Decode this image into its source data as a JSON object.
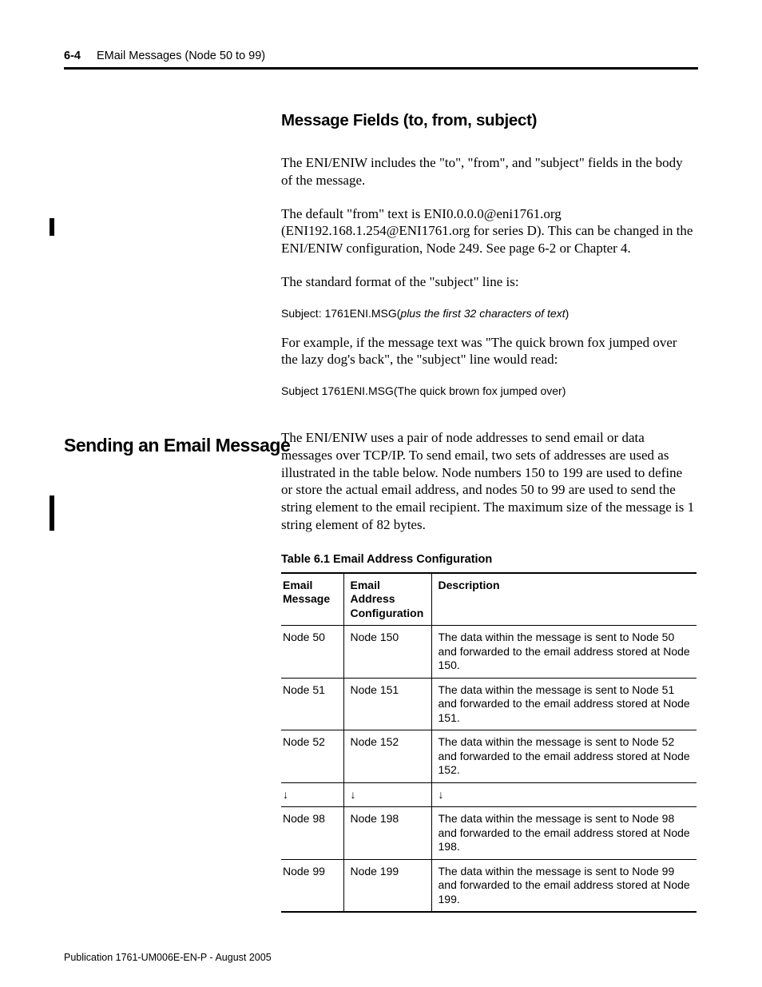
{
  "header": {
    "page_num": "6-4",
    "title": "EMail Messages (Node 50 to 99)"
  },
  "section1": {
    "heading": "Message Fields (to, from, subject)",
    "p1": "The ENI/ENIW includes the \"to\", \"from\", and \"subject\" fields in the body of the message.",
    "p2": "The default \"from\" text is ENI0.0.0.0@eni1761.org (ENI192.168.1.254@ENI1761.org for series D). This can be changed in the ENI/ENIW configuration, Node 249. See page 6-2 or Chapter 4.",
    "p3": "The standard format of the \"subject\" line is:",
    "subj_fmt_prefix": "Subject: 1761ENI.MSG(",
    "subj_fmt_italic": "plus the first 32 characters of text",
    "subj_fmt_suffix": ")",
    "p4": "For example, if the message text was \"The quick brown fox jumped over the lazy dog's back\", the \"subject\" line would read:",
    "subj_example": "Subject 1761ENI.MSG(The quick brown fox jumped over)"
  },
  "section2": {
    "side_heading": "Sending an Email Message",
    "p1": "The ENI/ENIW uses a pair of node addresses to send email or data messages over TCP/IP. To send email, two sets of addresses are used as illustrated in the table below. Node numbers 150 to 199 are used to define or store the actual email address, and nodes 50 to 99 are used to send the string element to the email recipient. The maximum size of the message is 1 string element of 82 bytes.",
    "table_caption": "Table 6.1 Email Address Configuration",
    "table": {
      "headers": [
        "Email Message",
        "Email Address Configuration",
        "Description"
      ],
      "rows": [
        [
          "Node 50",
          "Node 150",
          "The data within the message is sent to Node 50 and forwarded to the email address stored at Node 150."
        ],
        [
          "Node 51",
          "Node 151",
          "The data within the message is sent to Node 51 and forwarded to the email address stored at Node 151."
        ],
        [
          "Node 52",
          "Node 152",
          "The data within the message is sent to Node 52 and forwarded to the email address stored at Node 152."
        ],
        [
          "↓",
          "↓",
          "↓"
        ],
        [
          "Node 98",
          "Node 198",
          "The data within the message is sent to Node 98 and forwarded to the email address stored at Node 198."
        ],
        [
          "Node 99",
          "Node 199",
          "The data within the message is sent to Node 99 and forwarded to the email address stored at Node 199."
        ]
      ]
    }
  },
  "footer": "Publication 1761-UM006E-EN-P - August 2005"
}
